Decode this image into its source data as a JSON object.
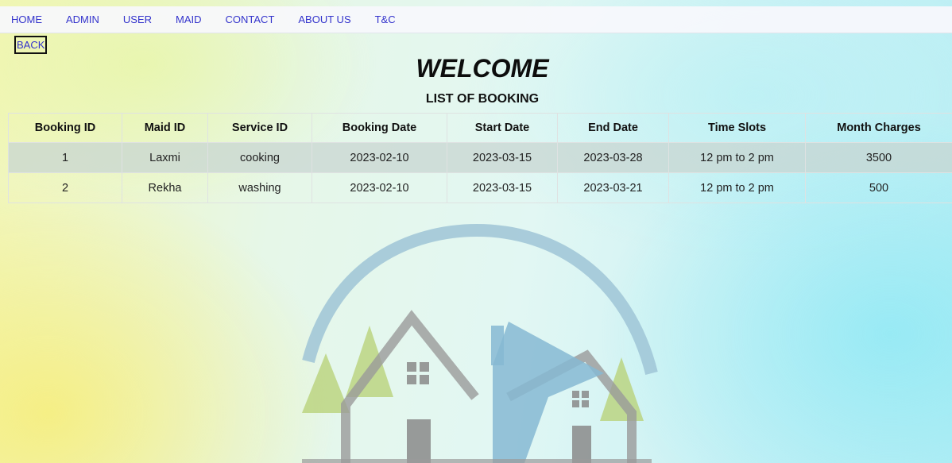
{
  "nav": {
    "items": [
      {
        "label": "HOME"
      },
      {
        "label": "ADMIN"
      },
      {
        "label": "USER"
      },
      {
        "label": "MAID"
      },
      {
        "label": "CONTACT"
      },
      {
        "label": "ABOUT US"
      },
      {
        "label": "T&C"
      }
    ]
  },
  "back_label": "BACK",
  "welcome": "WELCOME",
  "subtitle": "LIST OF BOOKING",
  "table": {
    "headers": [
      "Booking ID",
      "Maid ID",
      "Service ID",
      "Booking Date",
      "Start Date",
      "End Date",
      "Time Slots",
      "Month Charges"
    ],
    "rows": [
      [
        "1",
        "Laxmi",
        "cooking",
        "2023-02-10",
        "2023-03-15",
        "2023-03-28",
        "12 pm to 2 pm",
        "3500"
      ],
      [
        "2",
        "Rekha",
        "washing",
        "2023-02-10",
        "2023-03-15",
        "2023-03-21",
        "12 pm to 2 pm",
        "500"
      ]
    ]
  },
  "colors": {
    "nav_link": "#3333cc",
    "row_highlight": "#c8d6d2"
  }
}
